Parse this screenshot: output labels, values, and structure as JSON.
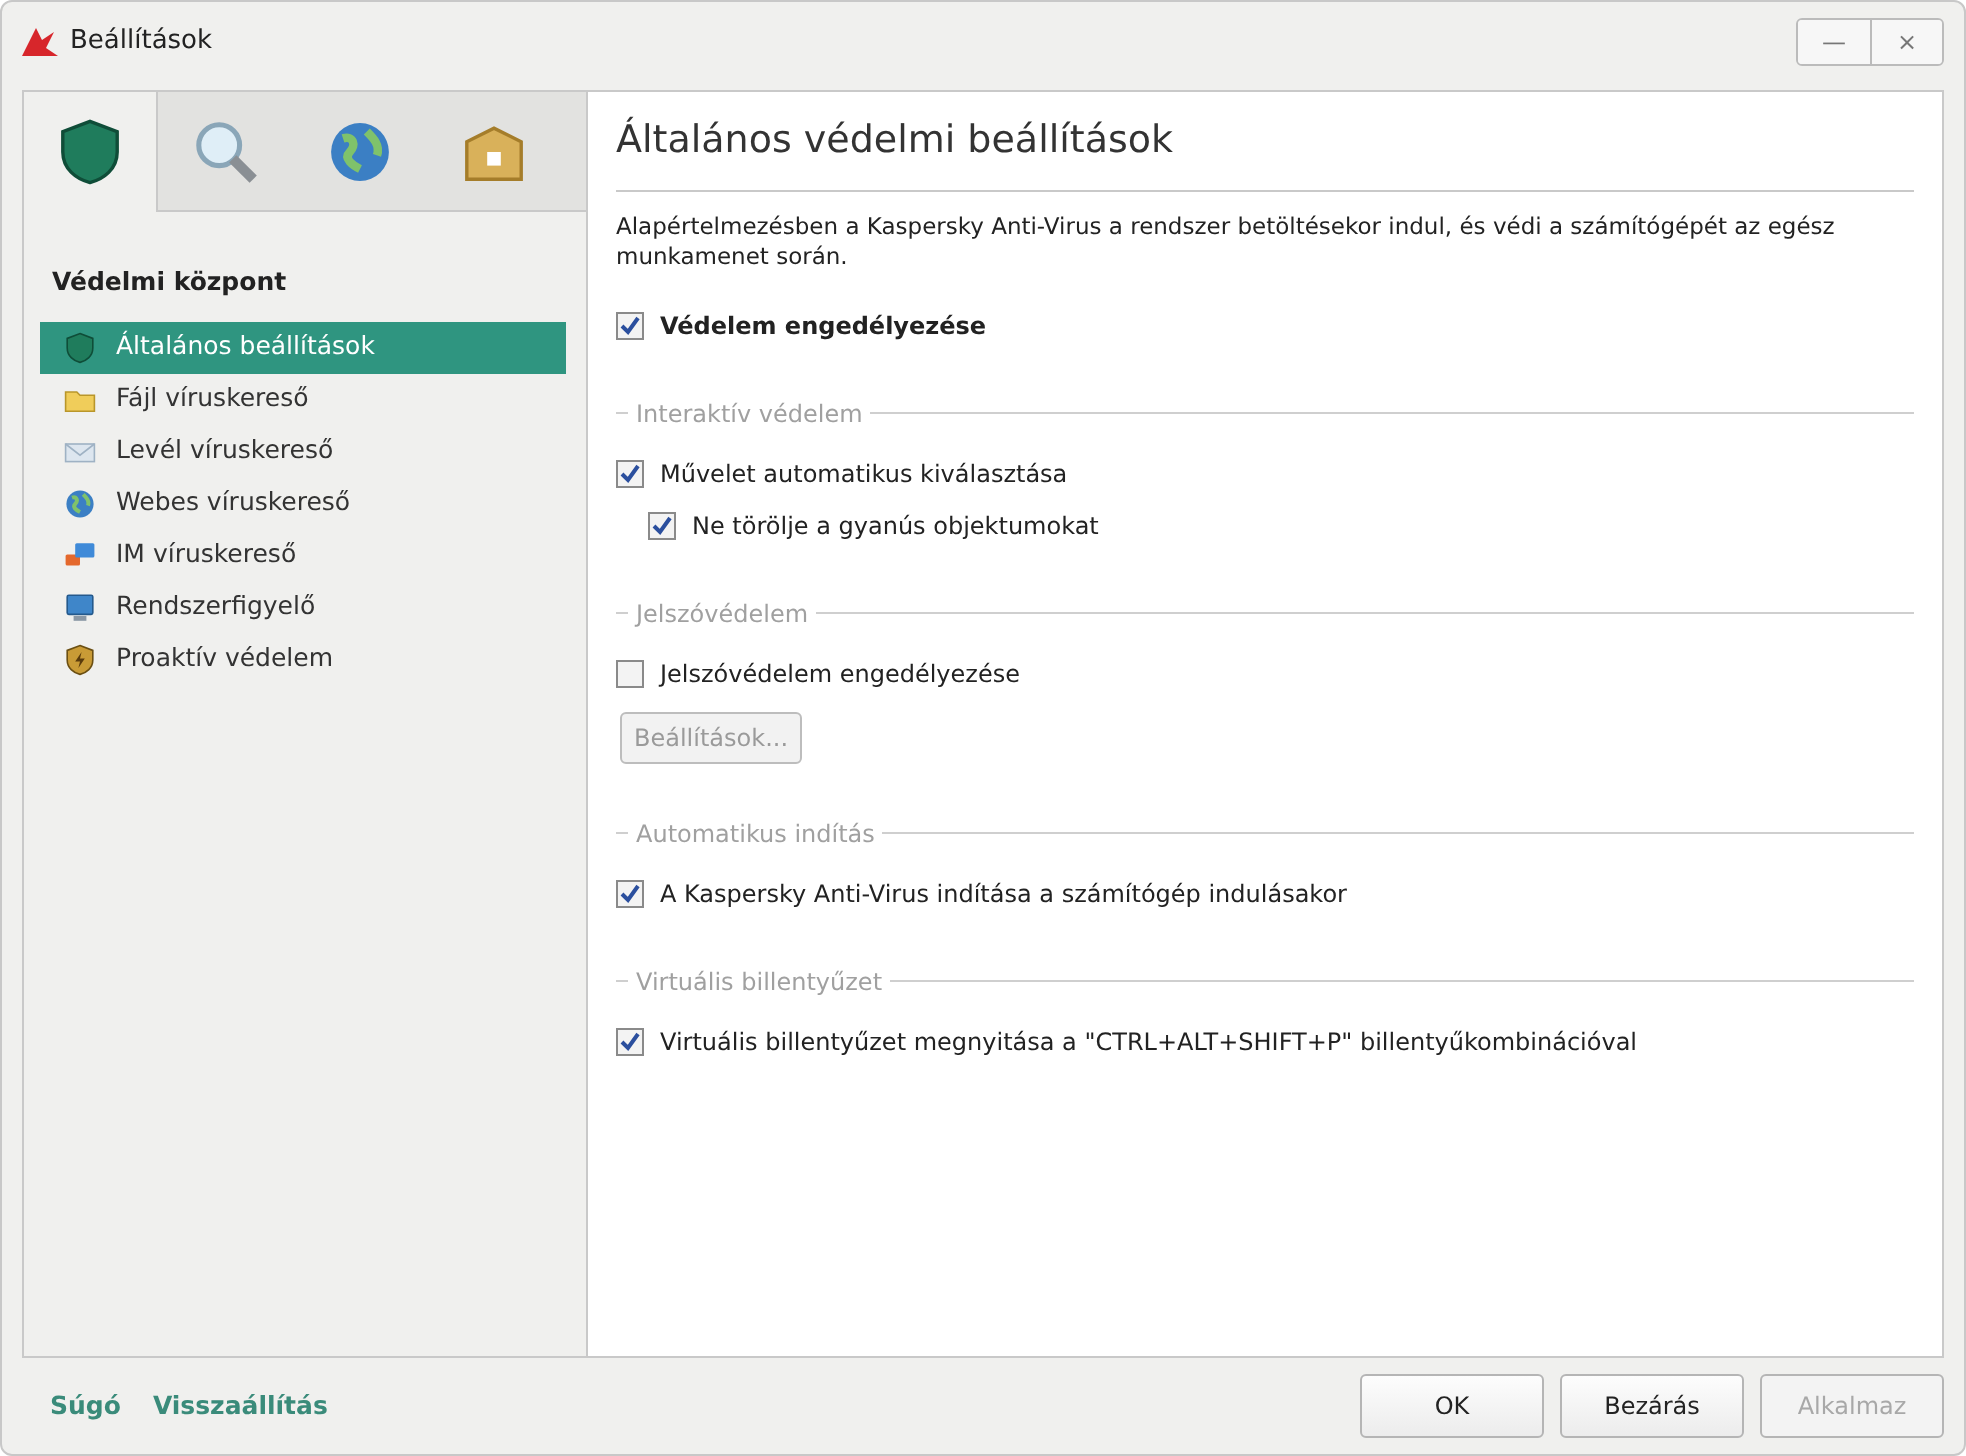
{
  "window": {
    "title": "Beállítások",
    "controls": [
      "—",
      "×"
    ]
  },
  "sidebar": {
    "tabs": [
      {
        "selected": true
      },
      {
        "selected": false
      },
      {
        "selected": false
      },
      {
        "selected": false
      }
    ],
    "heading": "Védelmi központ",
    "items": [
      {
        "label": "Általános beállítások",
        "selected": true
      },
      {
        "label": "Fájl víruskereső",
        "selected": false
      },
      {
        "label": "Levél víruskereső",
        "selected": false
      },
      {
        "label": "Webes víruskereső",
        "selected": false
      },
      {
        "label": "IM víruskereső",
        "selected": false
      },
      {
        "label": "Rendszerfigyelő",
        "selected": false
      },
      {
        "label": "Proaktív védelem",
        "selected": false
      }
    ]
  },
  "content": {
    "title": "Általános védelmi beállítások",
    "description": "Alapértelmezésben a Kaspersky Anti-Virus a rendszer betöltésekor indul, és védi a számítógépét az egész munkamenet során.",
    "rows": [
      {
        "kind": "checkbox",
        "label": "Védelem engedélyezése",
        "checked": true,
        "bold": true
      },
      {
        "kind": "group",
        "label": "Interaktív védelem"
      },
      {
        "kind": "checkbox",
        "label": "Művelet automatikus kiválasztása",
        "checked": true,
        "children": [
          {
            "kind": "checkbox",
            "label": "Ne törölje a gyanús objektumokat",
            "checked": true
          }
        ]
      },
      {
        "kind": "group",
        "label": "Jelszóvédelem"
      },
      {
        "kind": "checkbox",
        "label": "Jelszóvédelem engedélyezése",
        "checked": false
      },
      {
        "kind": "button",
        "label": "Beállítások...",
        "disabled": true
      },
      {
        "kind": "group",
        "label": "Automatikus indítás"
      },
      {
        "kind": "checkbox",
        "label": "A Kaspersky Anti-Virus indítása a számítógép indulásakor",
        "checked": true
      },
      {
        "kind": "group",
        "label": "Virtuális billentyűzet"
      },
      {
        "kind": "checkbox",
        "label": "Virtuális billentyűzet megnyitása a \"CTRL+ALT+SHIFT+P\" billentyűkombinációval",
        "checked": true
      }
    ]
  },
  "footer": {
    "links": [
      "Súgó",
      "Visszaállítás"
    ],
    "buttons": [
      {
        "label": "OK",
        "disabled": false
      },
      {
        "label": "Bezárás",
        "disabled": false
      },
      {
        "label": "Alkalmaz",
        "disabled": true
      }
    ]
  }
}
